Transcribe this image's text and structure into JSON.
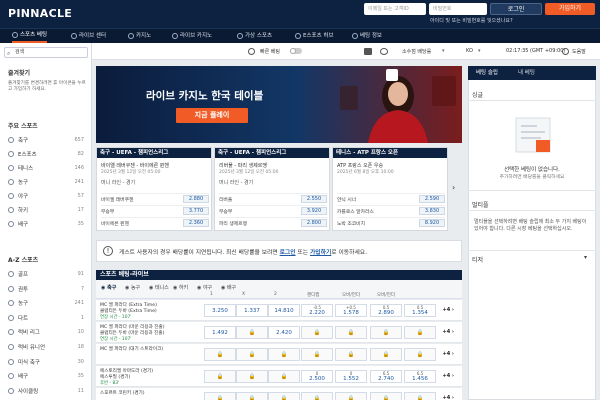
{
  "header": {
    "logo": "PINNACLE",
    "username_placeholder": "이메일 또는 고객ID",
    "password_placeholder": "비밀번호",
    "login_label": "로그인",
    "signup_label": "가입하기",
    "forgot_link": "아이디 및 또는 비밀번호를 잊으셨나요?"
  },
  "nav": [
    {
      "label": "스포츠 베팅",
      "icon": "trophy-icon",
      "active": true
    },
    {
      "label": "라이브 센터",
      "icon": "live-icon"
    },
    {
      "label": "카지노",
      "icon": "cards-icon"
    },
    {
      "label": "라이브 카지노",
      "icon": "dealer-icon"
    },
    {
      "label": "가상 스포츠",
      "icon": "virtual-icon"
    },
    {
      "label": "E스포츠 허브",
      "icon": "esports-icon"
    },
    {
      "label": "베팅 정보",
      "icon": "info-icon"
    }
  ],
  "filter": {
    "quick_bet_label": "빠른 베팅",
    "odds_format_label": "소수점 배당률",
    "region_label": "KO",
    "time_label": "02:17:35 (GMT +09:00)",
    "help_label": "도움말"
  },
  "sidebar": {
    "search_placeholder": "검색",
    "favorites_title": "즐겨찾기",
    "favorites_hint": "즐겨찾기를 변경하려면 휴 아이콘을 누르고 가입하기 하세요.",
    "main_title": "주요 스포츠",
    "main": [
      {
        "label": "축구",
        "count": "657"
      },
      {
        "label": "E스포츠",
        "count": "82"
      },
      {
        "label": "테니스",
        "count": "146"
      },
      {
        "label": "농구",
        "count": "241"
      },
      {
        "label": "야구",
        "count": "57"
      },
      {
        "label": "하키",
        "count": "17"
      },
      {
        "label": "배구",
        "count": "35"
      }
    ],
    "az_title": "A-Z 스포츠",
    "az": [
      {
        "label": "골프",
        "count": "91"
      },
      {
        "label": "권투",
        "count": "7"
      },
      {
        "label": "농구",
        "count": "241"
      },
      {
        "label": "다트",
        "count": "1"
      },
      {
        "label": "럭비 리그",
        "count": "10"
      },
      {
        "label": "럭비 유니언",
        "count": "18"
      },
      {
        "label": "미식 축구",
        "count": "30"
      },
      {
        "label": "배구",
        "count": "35"
      },
      {
        "label": "사이클링",
        "count": "11"
      }
    ]
  },
  "banner": {
    "title": "라이브 카지노 한국 테이블",
    "cta": "지금 플레이"
  },
  "cards": [
    {
      "header": "축구 - UEFA - 챔피언스리그",
      "teams": "바이엘 레버쿠젠 - 바이에른 뮌헨",
      "date": "2025년 3월 12일 오전 05:00",
      "market": "머니 라인 - 경기",
      "odds": [
        {
          "name": "바이엘 레버쿠젠",
          "value": "2.880"
        },
        {
          "name": "무승부",
          "value": "3.770"
        },
        {
          "name": "바이에른 뮌헨",
          "value": "2.360"
        }
      ]
    },
    {
      "header": "축구 - UEFA - 챔피언스리그",
      "teams": "리버풀 - 파리 생제르맹",
      "date": "2025년 3월 12일 오전 05:00",
      "market": "머니 라인 - 경기",
      "odds": [
        {
          "name": "리버풀",
          "value": "2.550"
        },
        {
          "name": "무승부",
          "value": "3.920"
        },
        {
          "name": "파리 생제르맹",
          "value": "2.800"
        }
      ]
    },
    {
      "header": "테니스 - ATP 프랑스 오픈",
      "teams": "ATP 프랑스 오픈 우승",
      "date": "2025년 6월 8일 오후 10:00",
      "market": "",
      "odds": [
        {
          "name": "얀닉 시너",
          "value": "2.590"
        },
        {
          "name": "카를로스 알카라스",
          "value": "3.830"
        },
        {
          "name": "노박 조코비치",
          "value": "8.920"
        }
      ]
    }
  ],
  "notice": {
    "text": "게스트 사용자의 경우 배당률이 지연됩니다. 최신 배당률을 보려면 ",
    "login": "로그인",
    "mid": " 또는 ",
    "signup": "가입하기",
    "end": "로 이동하세요."
  },
  "live": {
    "title": "스포츠 베팅-라이브",
    "tabs": [
      "축구",
      "농구",
      "테니스",
      "하키",
      "야구",
      "배구"
    ],
    "header_row": [
      "1",
      "X",
      "2",
      "핸디캡",
      "오버/언더",
      "오버/언더"
    ],
    "matches": [
      {
        "teams": "MC 엘 파라다 (Extra Time)",
        "teams2": "클럽티든 두바 (Extra Time)",
        "status": "연장 시간 - 107'",
        "odds": [
          "3.250",
          "1.337",
          "14.810"
        ],
        "handicap": [
          "-0.5",
          "2.220",
          "+0.5",
          "1.578"
        ],
        "ou1": [
          "0.5",
          "2.890"
        ],
        "ou2": [
          "0.5",
          "1.354"
        ]
      },
      {
        "teams": "MC 엘 파라다 (마운 리용과 진출)",
        "teams2": "클럽티든 두바 (마운 리용과 진출)",
        "status": "연장 시간 - 107'",
        "odds": [
          "1.492",
          "",
          "2.420"
        ],
        "handicap": [],
        "ou1": [],
        "ou2": []
      },
      {
        "teams": "MC 엘 파라다 (대기 스트라이크)",
        "teams2": "",
        "status": "",
        "odds": [
          "",
          "",
          ""
        ],
        "handicap": [],
        "ou1": [],
        "ou2": []
      },
      {
        "teams": "에스토리엘 아마도라 (경기)",
        "teams2": "에스투필 (경기)",
        "status": "후반 - 83'",
        "odds": [
          "",
          "",
          ""
        ],
        "handicap": [
          "0",
          "2.500",
          "0",
          "1.552"
        ],
        "ou1": [
          "6.5",
          "2.740"
        ],
        "ou2": [
          "6.5",
          "1.456"
        ]
      },
      {
        "teams": "스포르트 코린키 (경기)",
        "teams2": "",
        "status": "",
        "odds": [
          "",
          "",
          ""
        ],
        "handicap": [],
        "ou1": [],
        "ou2": []
      }
    ]
  },
  "rightpanel": {
    "tab1": "베팅 슬립",
    "tab2": "내 베팅",
    "single_title": "싱글",
    "empty_title": "선택한 베팅이 없습니다.",
    "empty_text": "추가하려면 배당률을 클릭하세요",
    "multi_title": "멀티플",
    "multi_text": "멀티플을 선택하려면 배팅 슬립에 최소 두 가지 베팅이 있어야 합니다. 다른 시장 베팅을 선택하십시오.",
    "teaser_title": "티저"
  }
}
